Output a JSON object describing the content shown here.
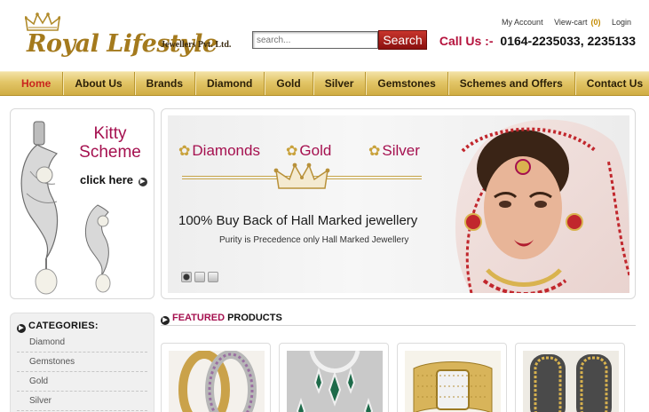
{
  "brand": {
    "name": "Royal Lifestyle",
    "subtitle": "Jewellers Pvt. Ltd."
  },
  "top_links": {
    "account": "My Account",
    "cart": "View-cart",
    "cart_count": "(0)",
    "login": "Login"
  },
  "search": {
    "placeholder": "search...",
    "button_label": "Search"
  },
  "call": {
    "label": "Call Us :-",
    "numbers": "0164-2235033, 2235133"
  },
  "nav": {
    "items": [
      {
        "label": "Home"
      },
      {
        "label": "About Us"
      },
      {
        "label": "Brands"
      },
      {
        "label": "Diamond"
      },
      {
        "label": "Gold"
      },
      {
        "label": "Silver"
      },
      {
        "label": "Gemstones"
      },
      {
        "label": "Schemes and Offers"
      },
      {
        "label": "Contact Us"
      }
    ]
  },
  "promo": {
    "title": "Kitty Scheme",
    "cta": "click here"
  },
  "banner": {
    "metals": [
      "Diamonds",
      "Gold",
      "Silver"
    ],
    "headline": "100% Buy Back of Hall Marked jewellery",
    "subline": "Purity is Precedence only Hall Marked Jewellery",
    "slides": 3,
    "active_slide": 1
  },
  "categories": {
    "heading": "CATEGORIES:",
    "items": [
      {
        "label": "Diamond"
      },
      {
        "label": "Gemstones"
      },
      {
        "label": "Gold"
      },
      {
        "label": "Silver"
      }
    ]
  },
  "featured": {
    "heading_word1": "FEATURED",
    "heading_word2": "PRODUCTS"
  },
  "colors": {
    "accent": "#a5104f",
    "nav_gold": "#d9b95a",
    "search_red": "#a81d18",
    "active_nav": "#c9251e"
  },
  "icons": [
    "crown-icon",
    "flower-icon",
    "arrow-circle-icon"
  ]
}
